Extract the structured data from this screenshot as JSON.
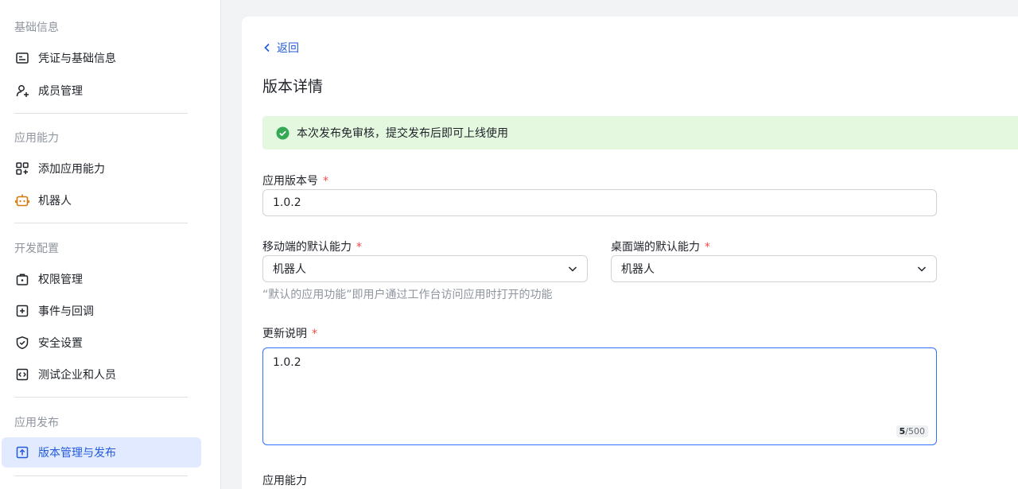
{
  "sidebar": {
    "sections": [
      {
        "title": "基础信息",
        "items": [
          {
            "label": "凭证与基础信息",
            "icon": "credential-icon"
          },
          {
            "label": "成员管理",
            "icon": "add-member-icon"
          }
        ]
      },
      {
        "title": "应用能力",
        "items": [
          {
            "label": "添加应用能力",
            "icon": "add-capability-icon"
          },
          {
            "label": "机器人",
            "icon": "robot-icon"
          }
        ]
      },
      {
        "title": "开发配置",
        "items": [
          {
            "label": "权限管理",
            "icon": "permission-icon"
          },
          {
            "label": "事件与回调",
            "icon": "event-icon"
          },
          {
            "label": "安全设置",
            "icon": "shield-icon"
          },
          {
            "label": "测试企业和人员",
            "icon": "code-icon"
          }
        ]
      },
      {
        "title": "应用发布",
        "items": [
          {
            "label": "版本管理与发布",
            "icon": "upload-icon",
            "active": true
          }
        ]
      }
    ]
  },
  "main": {
    "back_label": "返回",
    "title": "版本详情",
    "notice": "本次发布免审核，提交发布后即可上线使用",
    "version_label": "应用版本号",
    "version_value": "1.0.2",
    "mobile_label": "移动端的默认能力",
    "mobile_value": "机器人",
    "desktop_label": "桌面端的默认能力",
    "desktop_value": "机器人",
    "default_hint": "“默认的应用功能”即用户通过工作台访问应用时打开的功能",
    "notes_label": "更新说明",
    "notes_value": "1.0.2",
    "notes_count": "5",
    "notes_max": "/500",
    "capability_label": "应用能力",
    "required_mark": "*"
  },
  "colors": {
    "accent": "#245bdb",
    "active_bg": "#e1eaff",
    "notice_bg": "#e4f8e0",
    "success": "#34a853",
    "required": "#f54a45",
    "robot": "#d97706"
  }
}
